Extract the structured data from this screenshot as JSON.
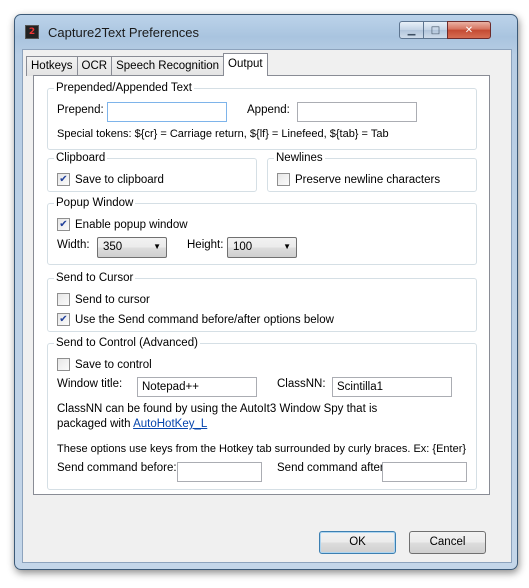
{
  "window": {
    "title": "Capture2Text Preferences",
    "app_icon_text": "2"
  },
  "tabs": [
    {
      "label": "Hotkeys"
    },
    {
      "label": "OCR"
    },
    {
      "label": "Speech Recognition"
    },
    {
      "label": "Output",
      "active": true
    }
  ],
  "prepended": {
    "group_label": "Prepended/Appended Text",
    "prepend_label": "Prepend:",
    "prepend_value": "",
    "append_label": "Append:",
    "append_value": "",
    "tokens_text": "Special tokens:  ${cr} = Carriage return,  ${lf} = Linefeed,  ${tab} = Tab"
  },
  "clipboard": {
    "group_label": "Clipboard",
    "save_label": "Save to clipboard",
    "save_checked": true
  },
  "newlines": {
    "group_label": "Newlines",
    "preserve_label": "Preserve newline characters",
    "preserve_checked": false
  },
  "popup": {
    "group_label": "Popup Window",
    "enable_label": "Enable popup window",
    "enable_checked": true,
    "width_label": "Width:",
    "width_value": "350",
    "height_label": "Height:",
    "height_value": "100"
  },
  "cursor": {
    "group_label": "Send to Cursor",
    "send_label": "Send to cursor",
    "send_checked": false,
    "use_cmd_label": "Use the Send command before/after options below",
    "use_cmd_checked": true
  },
  "control": {
    "group_label": "Send to Control (Advanced)",
    "save_label": "Save to control",
    "save_checked": false,
    "window_title_label": "Window title:",
    "window_title_value": "Notepad++",
    "classnn_label": "ClassNN:",
    "classnn_value": "Scintilla1",
    "info_line1": "ClassNN can be found by using the AutoIt3 Window Spy that is",
    "info_line2_prefix": "packaged with ",
    "info_link": "AutoHotKey_L",
    "hotkey_note": "These options use keys from the Hotkey tab surrounded by curly braces. Ex: {Enter}",
    "before_label": "Send command before:",
    "before_value": "",
    "after_label": "Send command after",
    "after_value": ""
  },
  "buttons": {
    "ok": "OK",
    "cancel": "Cancel"
  },
  "glyphs": {
    "check": "✔",
    "arrow": "▼",
    "minimize": "▁",
    "maximize": "□",
    "close": "✕"
  }
}
